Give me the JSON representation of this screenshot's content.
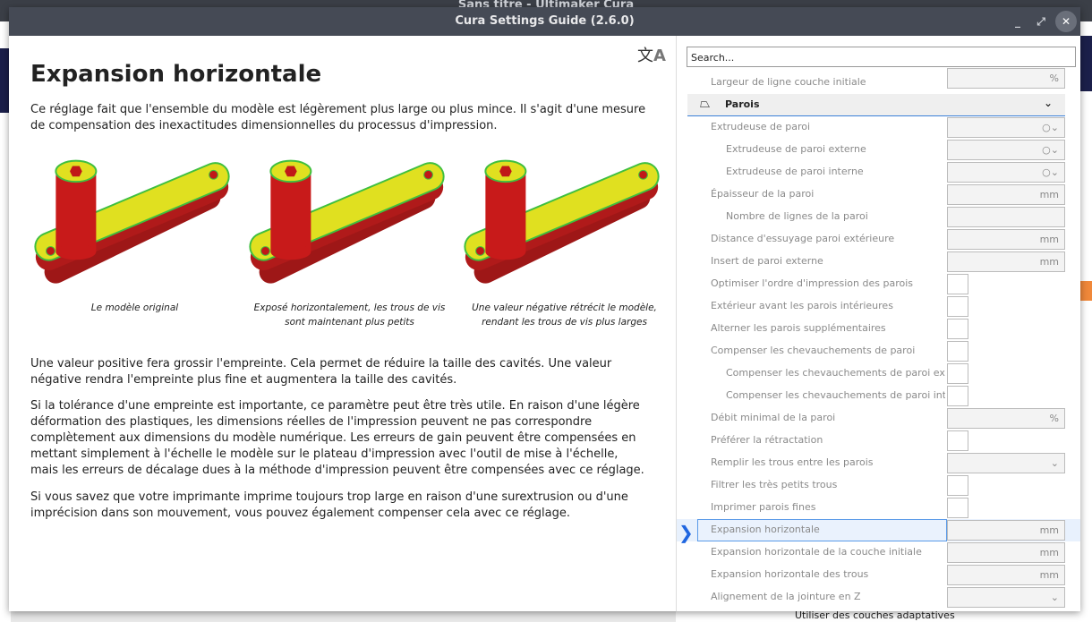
{
  "background": {
    "title": "Sans titre - Ultimaker Cura",
    "bottom_item": "Utiliser des couches adaptatives"
  },
  "dialog": {
    "title": "Cura Settings Guide (2.6.0)"
  },
  "article": {
    "title": "Expansion horizontale",
    "intro": "Ce réglage fait que l'ensemble du modèle est légèrement plus large ou plus mince. Il s'agit d'une mesure de compensation des inexactitudes dimensionnelles du processus d'impression.",
    "figures": [
      {
        "caption": "Le modèle original"
      },
      {
        "caption": "Exposé horizontalement, les trous de vis sont maintenant plus petits"
      },
      {
        "caption": "Une valeur négative rétrécit le modèle, rendant les trous de vis plus larges"
      }
    ],
    "paragraphs": [
      "Une valeur positive fera grossir l'empreinte. Cela permet de réduire la taille des cavités. Une valeur négative rendra l'empreinte plus fine et augmentera la taille des cavités.",
      "Si la tolérance d'une empreinte est importante, ce paramètre peut être très utile. En raison d'une légère déformation des plastiques, les dimensions réelles de l'impression peuvent ne pas correspondre complètement aux dimensions du modèle numérique. Les erreurs de gain peuvent être compensées en mettant simplement à l'échelle le modèle sur le plateau d'impression avec l'outil de mise à l'échelle, mais les erreurs de décalage dues à la méthode d'impression peuvent être compensées avec ce réglage.",
      "Si vous savez que votre imprimante imprime toujours trop large en raison d'une surextrusion ou d'une imprécision dans son mouvement, vous pouvez également compenser cela avec ce réglage."
    ]
  },
  "settings": {
    "search_placeholder": "Search...",
    "top_row": {
      "label": "Largeur de ligne couche initiale",
      "unit": "%"
    },
    "category": "Parois",
    "rows": [
      {
        "label": "Extrudeuse de paroi",
        "type": "extruder",
        "unit": "○⌄"
      },
      {
        "label": "Extrudeuse de paroi externe",
        "type": "extruder",
        "indent": true,
        "unit": "○⌄"
      },
      {
        "label": "Extrudeuse de paroi interne",
        "type": "extruder",
        "indent": true,
        "unit": "○⌄"
      },
      {
        "label": "Épaisseur de la paroi",
        "unit": "mm"
      },
      {
        "label": "Nombre de lignes de la paroi",
        "indent": true,
        "unit": ""
      },
      {
        "label": "Distance d'essuyage paroi extérieure",
        "unit": "mm"
      },
      {
        "label": "Insert de paroi externe",
        "unit": "mm"
      },
      {
        "label": "Optimiser l'ordre d'impression des parois",
        "type": "check"
      },
      {
        "label": "Extérieur avant les parois intérieures",
        "type": "check"
      },
      {
        "label": "Alterner les parois supplémentaires",
        "type": "check"
      },
      {
        "label": "Compenser les chevauchements de paroi",
        "type": "check"
      },
      {
        "label": "Compenser les chevauchements de paroi externe",
        "type": "check",
        "indent": true
      },
      {
        "label": "Compenser les chevauchements de paroi intérieure",
        "type": "check",
        "indent": true
      },
      {
        "label": "Débit minimal de la paroi",
        "unit": "%"
      },
      {
        "label": "Préférer la rétractation",
        "type": "check"
      },
      {
        "label": "Remplir les trous entre les parois",
        "unit": "⌄"
      },
      {
        "label": "Filtrer les très petits trous",
        "type": "check"
      },
      {
        "label": "Imprimer parois fines",
        "type": "check"
      },
      {
        "label": "Expansion horizontale",
        "unit": "mm",
        "selected": true
      },
      {
        "label": "Expansion horizontale de la couche initiale",
        "unit": "mm"
      },
      {
        "label": "Expansion horizontale des trous",
        "unit": "mm"
      },
      {
        "label": "Alignement de la jointure en Z",
        "unit": "⌄"
      }
    ]
  }
}
